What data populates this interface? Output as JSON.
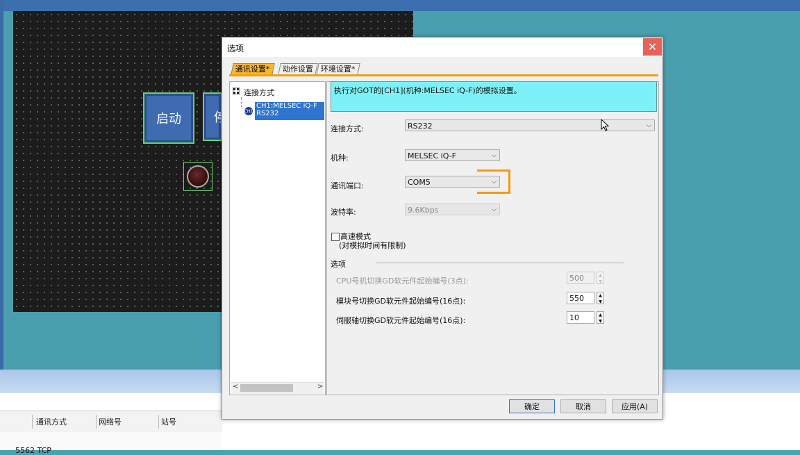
{
  "background": {
    "hmi_start_label": "启动",
    "hmi_stop_label_partial": "停",
    "bottom_columns": [
      "通讯方式",
      "网络号",
      "站号"
    ],
    "bottom_row_partial": "5562 TCP"
  },
  "dialog": {
    "title": "选项",
    "close_glyph": "✕",
    "tabs": [
      "通讯设置*",
      "动作设置",
      "环境设置*"
    ],
    "tree": {
      "root": "连接方式",
      "child_badge": "CH1",
      "child_line1": "CH1:MELSEC iQ-F",
      "child_line2": "RS232"
    },
    "info": "执行对GOT的[CH1](机种:MELSEC iQ-F)的模拟设置。",
    "fields": {
      "conn_label": "连接方式:",
      "conn_value": "RS232",
      "model_label": "机种:",
      "model_value": "MELSEC iQ-F",
      "port_label": "通讯端口:",
      "port_value": "COM5",
      "baud_label": "波特率:",
      "baud_value": "9.6Kbps"
    },
    "highspeed": {
      "label": "高速模式",
      "note": "(对模拟时间有限制)"
    },
    "options": {
      "section": "选项",
      "cpu_label": "CPU号机切换GD软元件起始编号(3点):",
      "cpu_value": "500",
      "module_label": "模块号切换GD软元件起始编号(16点):",
      "module_value": "550",
      "servo_label": "伺服轴切换GD软元件起始编号(16点):",
      "servo_value": "10"
    },
    "buttons": {
      "ok": "确定",
      "cancel": "取消",
      "apply": "应用(A)"
    }
  }
}
